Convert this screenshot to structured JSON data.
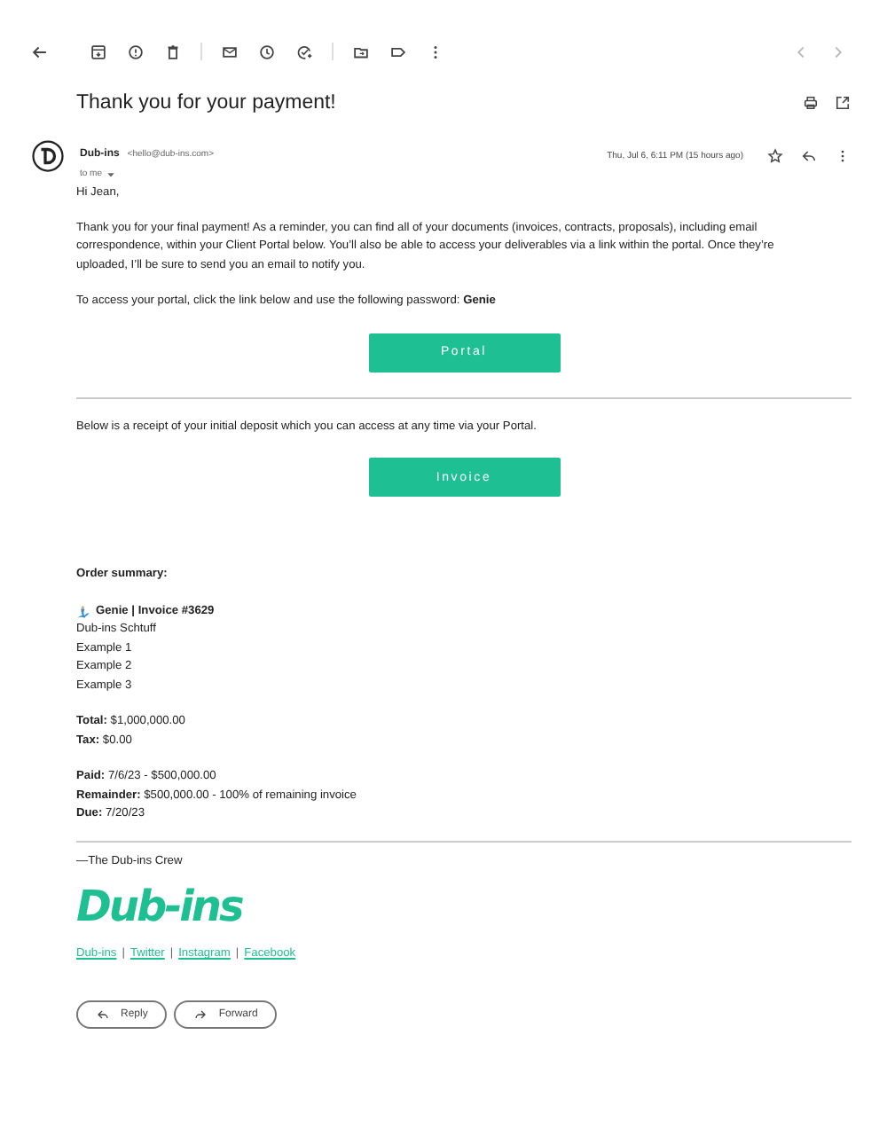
{
  "subject": "Thank you for your payment!",
  "sender": {
    "name": "Dub-ins",
    "email": "<hello@dub-ins.com>",
    "to": "to me",
    "date": "Thu, Jul 6, 6:11 PM (15 hours ago)",
    "starred": false
  },
  "greeting": "Hi Jean,",
  "paragraphs": [
    "Thank you for your final payment! As a reminder, you can find all of your documents (invoices, contracts, proposals), including email correspondence, within your Client Portal below. You’ll also be able to access your deliverables via a link within the portal. Once they’re uploaded, I’ll be sure to send you an email to notify you.",
    "To access your portal, click the link below and use the following password: **Genie**"
  ],
  "portal_button": "Portal",
  "receipt_text": "Below is a receipt of your initial deposit which you can access at any time via your Portal.",
  "invoice_button": "Invoice",
  "order": {
    "heading": "Order summary:",
    "title": "Genie | Invoice #3629",
    "items": [
      "Dub-ins Schtuff",
      "Example 1",
      "Example 2",
      "Example 3"
    ],
    "totals": [
      [
        "**Total:** $1,000,000.00",
        "**Tax:** $0.00"
      ],
      [
        "**Paid:** 7/6/23 - $500,000.00",
        "**Remainder:** $500,000.00 - 100% of remaining invoice",
        "**Due:** 7/20/23"
      ]
    ]
  },
  "signoff": "—The Dub-ins Crew",
  "logo": "Dub-ins",
  "links": [
    "Dub-ins",
    "Twitter",
    "Instagram",
    "Facebook"
  ],
  "link_separator": "|",
  "actions": [
    {
      "kind": "reply",
      "label": "Reply"
    },
    {
      "kind": "forward",
      "label": "Forward"
    }
  ]
}
